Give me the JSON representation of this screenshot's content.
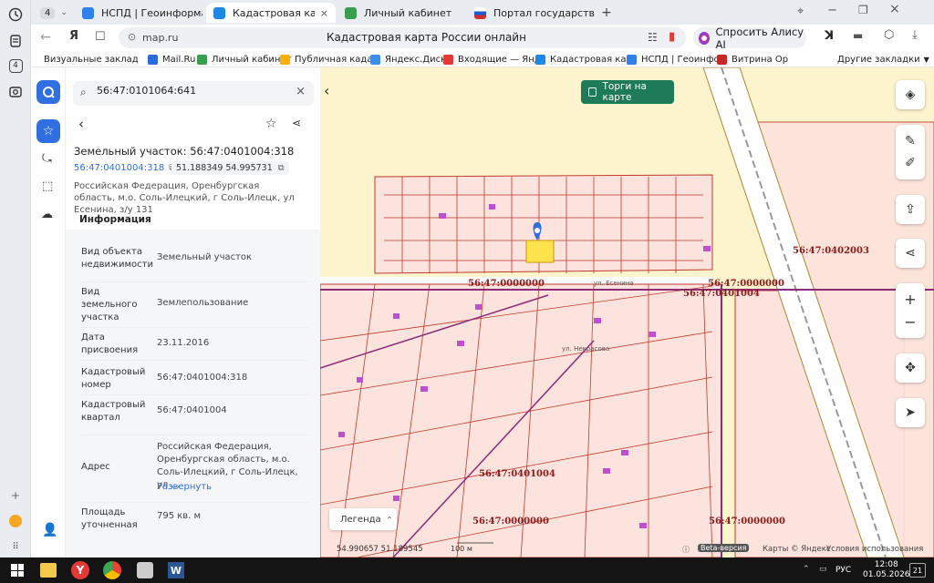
{
  "rail": {
    "badge1": "4",
    "badge2": "4"
  },
  "tabs": [
    {
      "label": "4",
      "kind": "counter"
    },
    {
      "label": "НСПД | Геоинформацион",
      "color": "#2f80ed"
    },
    {
      "label": "Кадастровая карта Рос",
      "color": "#1e88e5",
      "active": true
    },
    {
      "label": "Личный кабинет",
      "color": "#3a9e4f"
    },
    {
      "label": "Портал государственных",
      "color": "#d32f2f"
    }
  ],
  "address": {
    "url": "map.ru",
    "title": "Кадастровая карта России онлайн",
    "alice": "Спросить Алису AI"
  },
  "bookmarks": [
    {
      "label": "Визуальные заклад",
      "color": "#888"
    },
    {
      "label": "Mail.Ru",
      "color": "#2a6bdc"
    },
    {
      "label": "Личный кабинет",
      "color": "#3a9e4f"
    },
    {
      "label": "Публичная када",
      "color": "#ffb000"
    },
    {
      "label": "Яндекс.Диск",
      "color": "#3b8fe8"
    },
    {
      "label": "Входящие — Янд",
      "color": "#e53935"
    },
    {
      "label": "Кадастровая карт",
      "color": "#1e88e5"
    },
    {
      "label": "НСПД | Геоинфор",
      "color": "#2f80ed"
    },
    {
      "label": "Витрина Ор",
      "color": "#c62828"
    },
    {
      "label": "Другие закладки",
      "color": "#888"
    }
  ],
  "search": {
    "value": "56:47:0101064:641"
  },
  "parcel": {
    "title": "Земельный участок: 56:47:0401004:318",
    "cadnum": "56:47:0401004:318",
    "coords": "51.188349 54.995731",
    "address": "Российская Федерация, Оренбургская область, м.о. Соль-Илецкий, г Соль-Илецк, ул Есенина, з/у 131",
    "tab": "Информация",
    "rows": [
      {
        "k": "Вид объекта недвижимости",
        "v": "Земельный участок"
      },
      {
        "k": "Вид земельного участка",
        "v": "Землепользование"
      },
      {
        "k": "Дата присвоения",
        "v": "23.11.2016"
      },
      {
        "k": "Кадастровый номер",
        "v": "56:47:0401004:318"
      },
      {
        "k": "Кадастровый квартал",
        "v": "56:47:0401004"
      },
      {
        "k": "Адрес",
        "v": "Российская Федерация, Оренбургская область, м.о. Соль-Илецкий, г Соль-Илецк, ул ...",
        "link": "Развернуть"
      },
      {
        "k": "Площадь уточненная",
        "v": "795 кв. м"
      }
    ]
  },
  "map": {
    "auction": "Торги на карте",
    "legend": "Легенда",
    "quarters": [
      {
        "text": "56:47:0402003"
      },
      {
        "text": "56:47:0000000"
      },
      {
        "text": "56:47:0000000"
      },
      {
        "text": "56:47:0401004"
      },
      {
        "text": "56:47:0401004"
      },
      {
        "text": "56:47:0000000"
      },
      {
        "text": "56:47:0000000"
      }
    ],
    "street1": "ул. Есенина",
    "street2": "ул. Некрасова",
    "scale": "100 м",
    "coords": "54.990657  51.189545",
    "beta": "Beta-версия",
    "copyright": "Карты © Яндекс",
    "terms": "Условия использования"
  },
  "taskbar": {
    "lang": "РУС",
    "time": "12:08",
    "date": "01.05.2026",
    "notif": "21"
  }
}
